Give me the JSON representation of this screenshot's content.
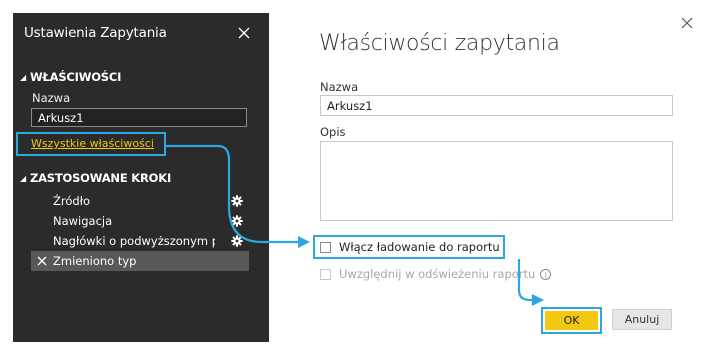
{
  "panel": {
    "title": "Ustawienia Zapytania",
    "properties_header": "WŁAŚCIWOŚCI",
    "name_label": "Nazwa",
    "name_value": "Arkusz1",
    "all_properties_link": "Wszystkie właściwości",
    "steps_header": "ZASTOSOWANE KROKI",
    "steps": [
      {
        "label": "Źródło",
        "has_gear": true
      },
      {
        "label": "Nawigacja",
        "has_gear": true
      },
      {
        "label": "Nagłówki o podwyższonym p...",
        "has_gear": true
      },
      {
        "label": "Zmieniono typ",
        "has_gear": false,
        "selected": true
      }
    ]
  },
  "dialog": {
    "title": "Właściwości zapytania",
    "name_label": "Nazwa",
    "name_value": "Arkusz1",
    "description_label": "Opis",
    "description_value": "",
    "load_checkbox_label": "Włącz ładowanie do raportu",
    "load_checked": false,
    "refresh_checkbox_label": "Uwzględnij w odświeżeniu raportu",
    "refresh_checked": false,
    "refresh_enabled": false,
    "ok_label": "OK",
    "cancel_label": "Anuluj"
  },
  "colors": {
    "panel_bg": "#2b2b2b",
    "accent_link": "#f2c811",
    "ok_button": "#f2c811",
    "annotation": "#2ea7e0"
  },
  "icons": {
    "close": "close-icon",
    "gear": "gear-icon",
    "info": "info-icon",
    "collapse": "triangle-down-icon",
    "step_active": "x-mark-icon"
  }
}
